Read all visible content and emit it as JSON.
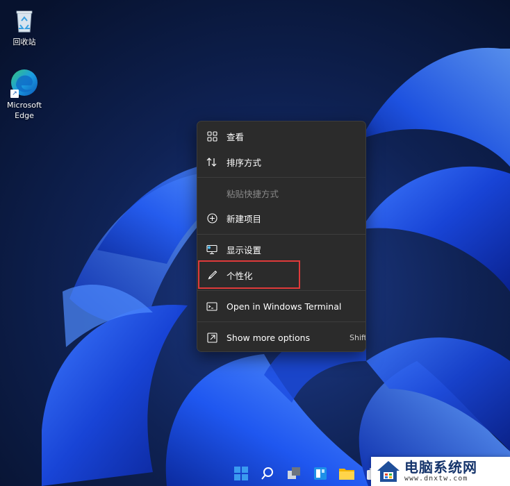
{
  "desktop": {
    "icons": [
      {
        "label": "回收站",
        "icon": "recycle-bin-icon"
      },
      {
        "label": "Microsoft Edge",
        "icon": "edge-icon"
      }
    ]
  },
  "context_menu": {
    "items": [
      {
        "label": "查看",
        "icon": "view-grid-icon"
      },
      {
        "label": "排序方式",
        "icon": "sort-icon"
      },
      {
        "label": "粘贴快捷方式",
        "disabled": true
      },
      {
        "label": "新建项目",
        "icon": "new-item-icon"
      },
      {
        "label": "显示设置",
        "icon": "display-settings-icon"
      },
      {
        "label": "个性化",
        "icon": "personalize-brush-icon",
        "highlighted": true
      },
      {
        "label": "Open in Windows Terminal",
        "icon": "terminal-icon"
      },
      {
        "label": "Show more options",
        "icon": "show-more-options-icon",
        "shortcut": "Shift"
      }
    ],
    "highlight_color": "#e03a3a"
  },
  "taskbar": {
    "icons": [
      "start-icon",
      "search-icon",
      "task-view-icon",
      "widgets-icon",
      "file-explorer-icon",
      "store-icon"
    ]
  },
  "watermark": {
    "title": "电脑系统网",
    "url": "www.dnxtw.com"
  }
}
